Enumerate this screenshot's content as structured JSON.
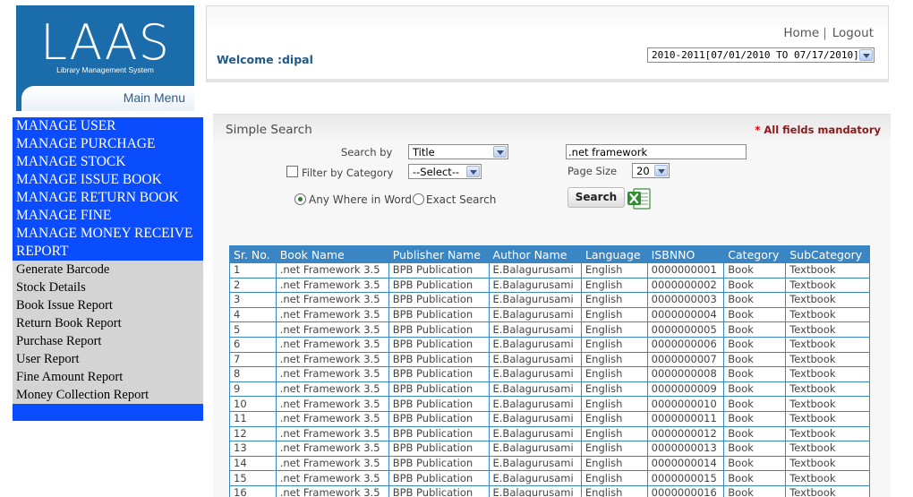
{
  "logo": {
    "word": "LAAS",
    "subtitle": "Library Management System"
  },
  "main_menu": {
    "label": "Main Menu"
  },
  "header": {
    "welcome": "Welcome :dipal",
    "home_link": "Home",
    "separator": "|",
    "logout_link": "Logout",
    "session_value": "2010-2011[07/01/2010 TO 07/17/2010]"
  },
  "nav": {
    "primary": [
      "MANAGE USER",
      "MANAGE PURCHAGE",
      "MANAGE STOCK",
      "MANAGE ISSUE BOOK",
      "MANAGE RETURN BOOK",
      "MANAGE FINE",
      "MANAGE MONEY RECEIVE",
      "REPORT"
    ],
    "reports": [
      "Generate Barcode",
      "Stock Details",
      "Book Issue Report",
      "Return Book Report",
      "Purchase Report",
      "User Report",
      "Fine Amount Report",
      "Money Collection Report"
    ]
  },
  "search": {
    "title": "Simple Search",
    "mandatory_star": "*",
    "mandatory_text": "All fields mandatory",
    "search_by_label": "Search by",
    "search_by_value": "Title",
    "search_text_value": ".net framework",
    "filter_label": "Filter by Category",
    "category_value": "--Select--",
    "page_size_label": "Page Size",
    "page_size_value": "20",
    "radio_any": "Any Where in Word",
    "radio_exact": "Exact Search",
    "search_button": "Search"
  },
  "table": {
    "columns": [
      "Sr. No.",
      "Book Name",
      "Publisher Name",
      "Author Name",
      "Language",
      "ISBNNO",
      "Category",
      "SubCategory"
    ],
    "rows": [
      [
        "1",
        ".net Framework 3.5",
        "BPB Publication",
        "E.Balagurusami",
        "English",
        "0000000001",
        "Book",
        "Textbook"
      ],
      [
        "2",
        ".net Framework 3.5",
        "BPB Publication",
        "E.Balagurusami",
        "English",
        "0000000002",
        "Book",
        "Textbook"
      ],
      [
        "3",
        ".net Framework 3.5",
        "BPB Publication",
        "E.Balagurusami",
        "English",
        "0000000003",
        "Book",
        "Textbook"
      ],
      [
        "4",
        ".net Framework 3.5",
        "BPB Publication",
        "E.Balagurusami",
        "English",
        "0000000004",
        "Book",
        "Textbook"
      ],
      [
        "5",
        ".net Framework 3.5",
        "BPB Publication",
        "E.Balagurusami",
        "English",
        "0000000005",
        "Book",
        "Textbook"
      ],
      [
        "6",
        ".net Framework 3.5",
        "BPB Publication",
        "E.Balagurusami",
        "English",
        "0000000006",
        "Book",
        "Textbook"
      ],
      [
        "7",
        ".net Framework 3.5",
        "BPB Publication",
        "E.Balagurusami",
        "English",
        "0000000007",
        "Book",
        "Textbook"
      ],
      [
        "8",
        ".net Framework 3.5",
        "BPB Publication",
        "E.Balagurusami",
        "English",
        "0000000008",
        "Book",
        "Textbook"
      ],
      [
        "9",
        ".net Framework 3.5",
        "BPB Publication",
        "E.Balagurusami",
        "English",
        "0000000009",
        "Book",
        "Textbook"
      ],
      [
        "10",
        ".net Framework 3.5",
        "BPB Publication",
        "E.Balagurusami",
        "English",
        "0000000010",
        "Book",
        "Textbook"
      ],
      [
        "11",
        ".net Framework 3.5",
        "BPB Publication",
        "E.Balagurusami",
        "English",
        "0000000011",
        "Book",
        "Textbook"
      ],
      [
        "12",
        ".net Framework 3.5",
        "BPB Publication",
        "E.Balagurusami",
        "English",
        "0000000012",
        "Book",
        "Textbook"
      ],
      [
        "13",
        ".net Framework 3.5",
        "BPB Publication",
        "E.Balagurusami",
        "English",
        "0000000013",
        "Book",
        "Textbook"
      ],
      [
        "14",
        ".net Framework 3.5",
        "BPB Publication",
        "E.Balagurusami",
        "English",
        "0000000014",
        "Book",
        "Textbook"
      ],
      [
        "15",
        ".net Framework 3.5",
        "BPB Publication",
        "E.Balagurusami",
        "English",
        "0000000015",
        "Book",
        "Textbook"
      ],
      [
        "16",
        ".net Framework 3.5",
        "BPB Publication",
        "E.Balagurusami",
        "English",
        "0000000016",
        "Book",
        "Textbook"
      ]
    ]
  },
  "colors": {
    "nav_blue": "#0a4cff",
    "nav_grey": "#d4d4d4",
    "table_header": "#3a86c4",
    "logo_blue": "#1b6cab",
    "mandatory": "#8b1a1a"
  }
}
